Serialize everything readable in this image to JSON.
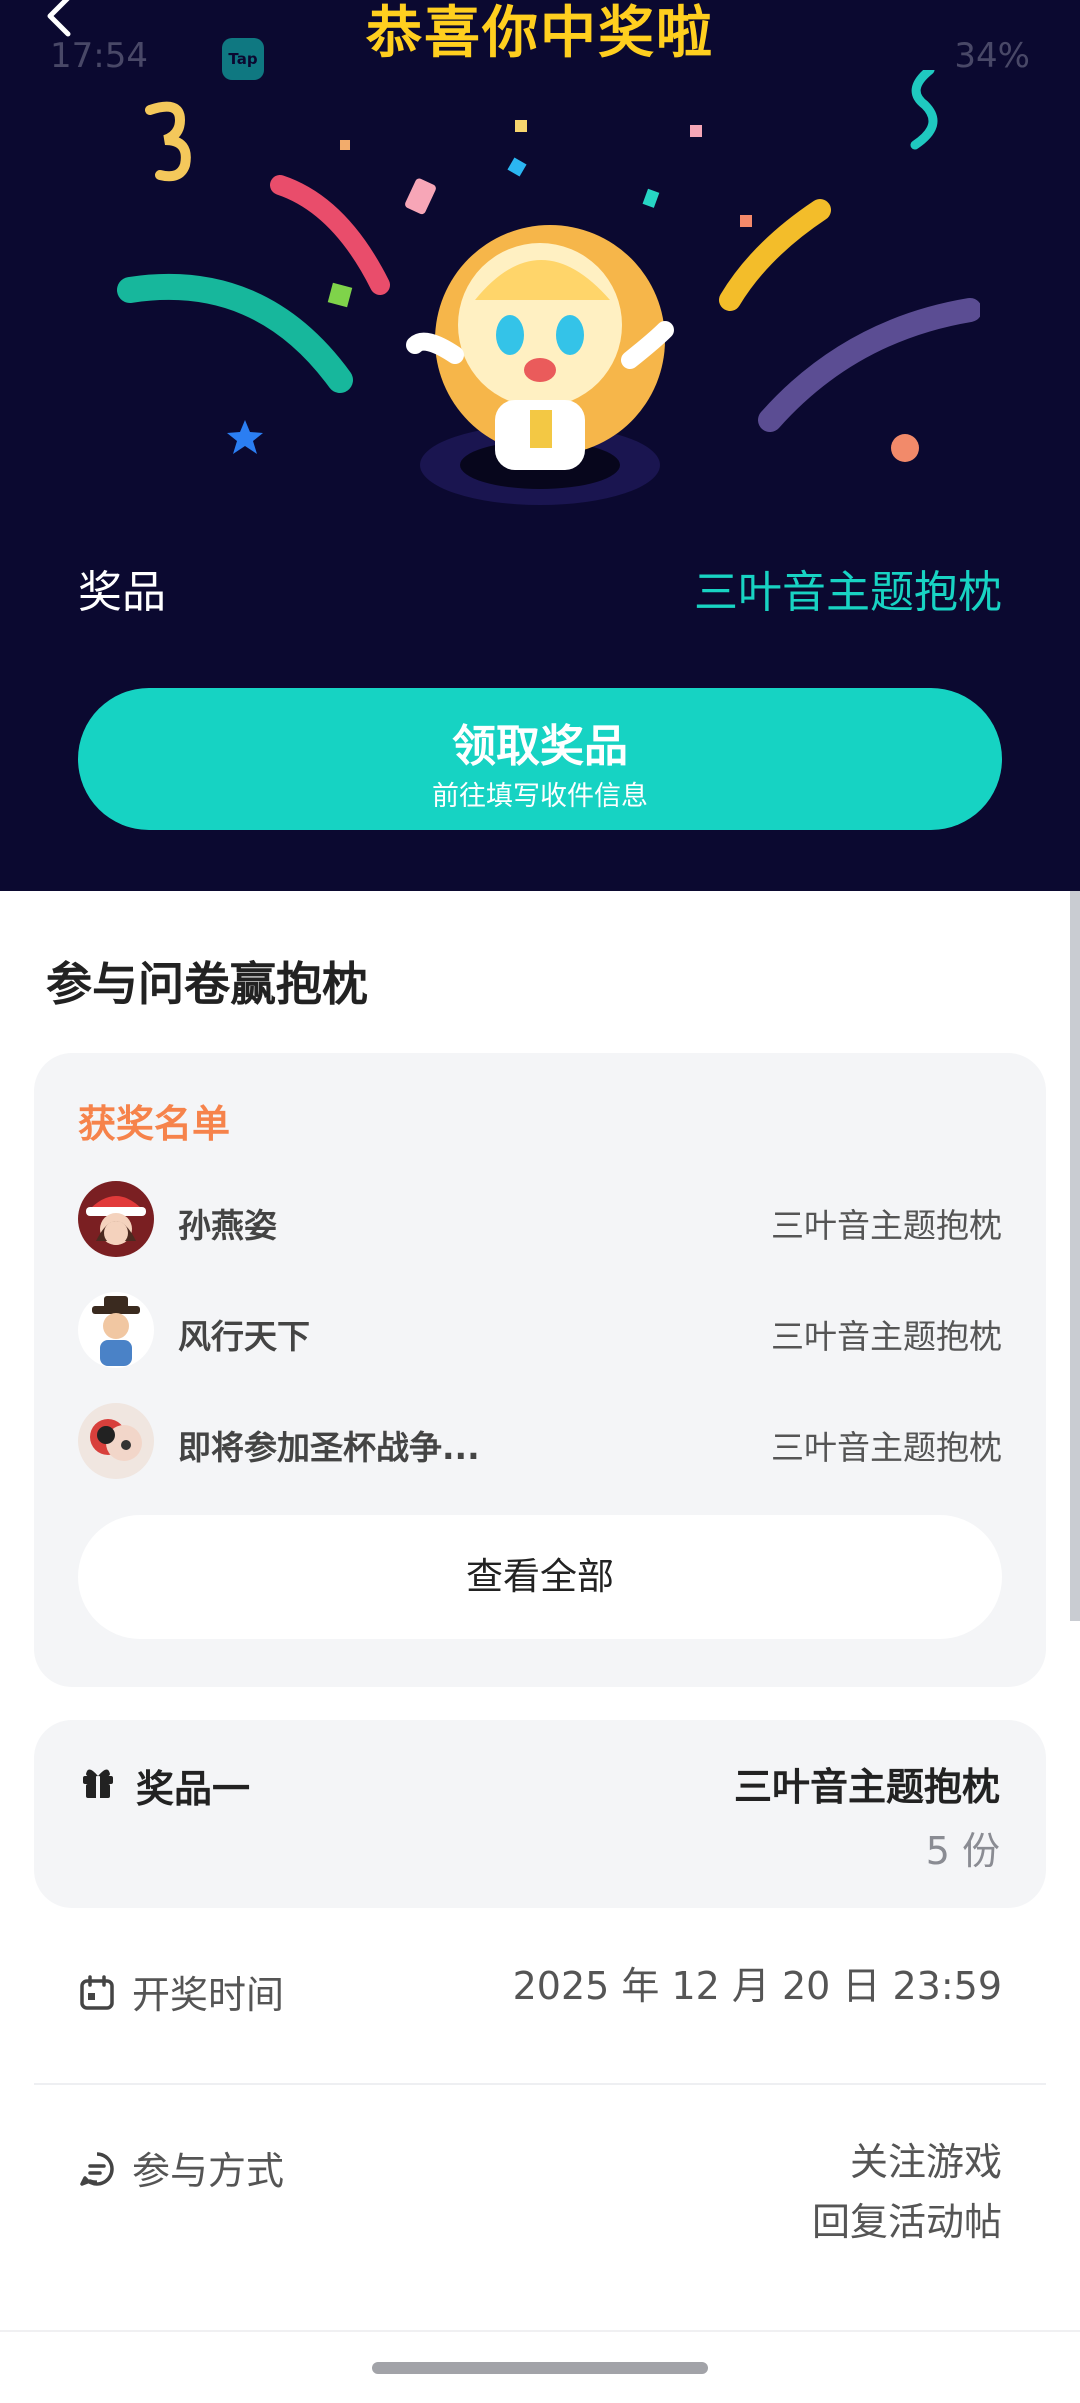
{
  "status_bar": {
    "time": "17:54",
    "battery": "34%",
    "tap_icon_label": "Tap"
  },
  "header": {
    "title": "恭喜你中奖啦",
    "back_icon": "chevron-left-icon"
  },
  "prize": {
    "label": "奖品",
    "value": "三叶音主题抱枕"
  },
  "claim_button": {
    "label": "领取奖品",
    "sublabel": "前往填写收件信息"
  },
  "section": {
    "title": "参与问卷赢抱枕"
  },
  "winners": {
    "title": "获奖名单",
    "rows": [
      {
        "name": "孙燕姿",
        "prize": "三叶音主题抱枕"
      },
      {
        "name": "风行天下",
        "prize": "三叶音主题抱枕"
      },
      {
        "name": "即将参加圣杯战争...",
        "prize": "三叶音主题抱枕"
      }
    ],
    "view_all": "查看全部"
  },
  "prize_card": {
    "label": "奖品一",
    "value": "三叶音主题抱枕",
    "count": "5 份",
    "icon": "gift-icon"
  },
  "draw_time": {
    "label": "开奖时间",
    "value": "2025 年 12 月 20 日 23:59",
    "icon": "calendar-icon"
  },
  "participation": {
    "label": "参与方式",
    "line1": "关注游戏",
    "line2": "回复活动帖",
    "icon": "chat-icon"
  },
  "colors": {
    "hero_bg": "#0b0930",
    "accent_teal": "#16d3c3",
    "title_yellow": "#ffcf1f",
    "winner_orange": "#f6834b"
  }
}
